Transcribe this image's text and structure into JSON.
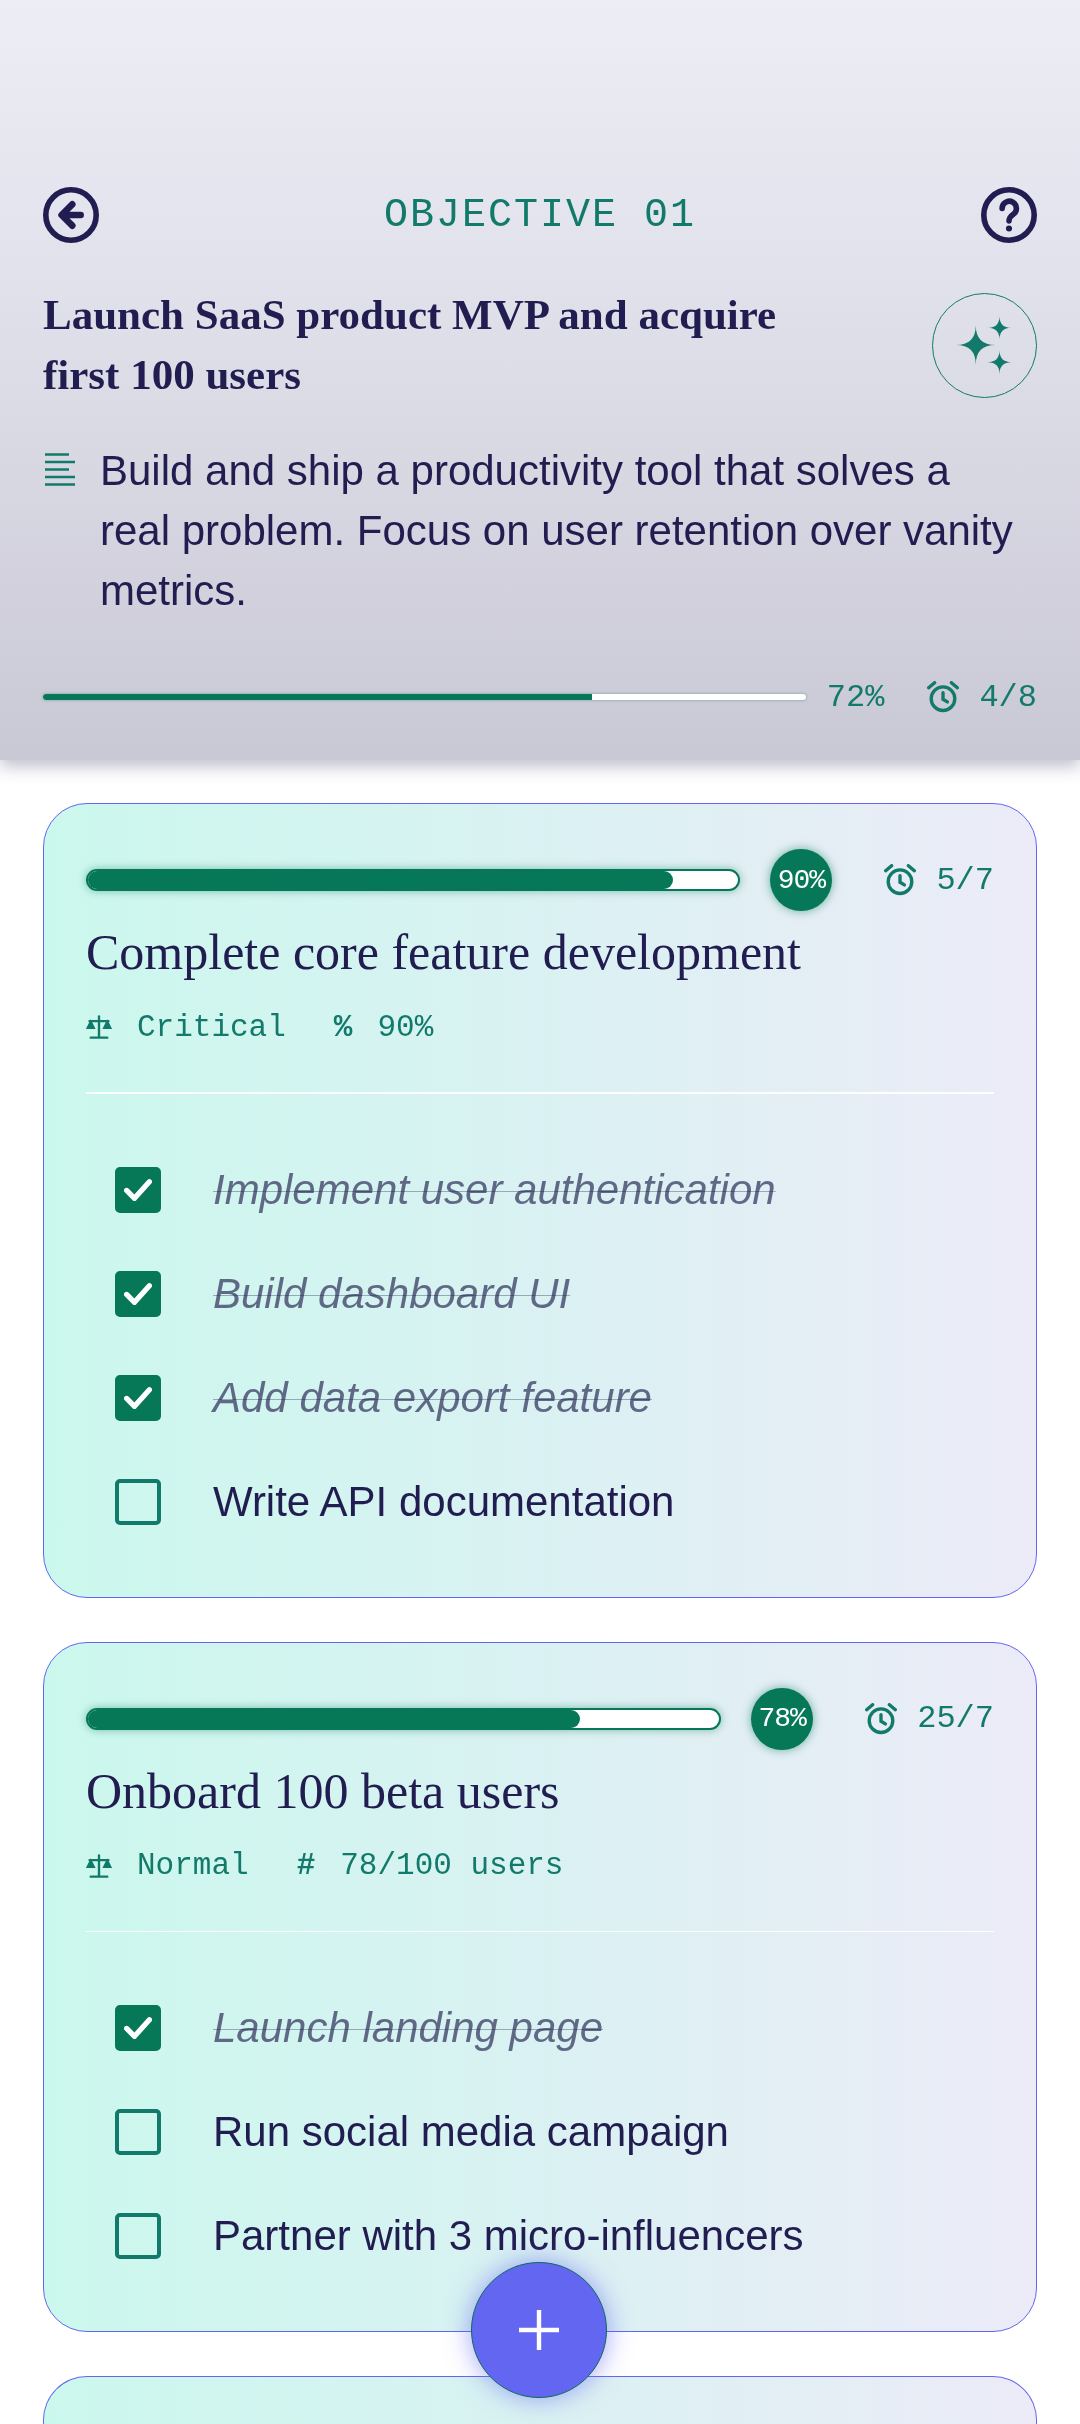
{
  "header": {
    "title": "OBJECTIVE 01",
    "objective": "Launch SaaS product MVP and acquire first 100 users",
    "description": "Build and ship a productivity tool that solves a real problem. Focus on user retention over vanity metrics.",
    "progress": {
      "level": 0.72,
      "percent": "72%",
      "tasks": "4/8"
    }
  },
  "key_results": [
    {
      "level": 0.9,
      "percent": "90%",
      "tasks_done": "5/7",
      "title": "Complete core feature development",
      "priority": "Critical",
      "metric_symbol": "%",
      "metric": "90%",
      "tasks": [
        {
          "label": "Implement user authentication",
          "checked": true
        },
        {
          "label": "Build dashboard UI",
          "checked": true
        },
        {
          "label": "Add data export feature",
          "checked": true
        },
        {
          "label": "Write API documentation",
          "checked": false
        }
      ]
    },
    {
      "level": 0.78,
      "percent": "78%",
      "tasks_done": "25/7",
      "title": "Onboard 100 beta users",
      "priority": "Normal",
      "metric_symbol": "#",
      "metric": "78/100 users",
      "tasks": [
        {
          "label": "Launch landing page",
          "checked": true
        },
        {
          "label": "Run social media campaign",
          "checked": false
        },
        {
          "label": "Partner with 3 micro-influencers",
          "checked": false
        }
      ]
    }
  ]
}
